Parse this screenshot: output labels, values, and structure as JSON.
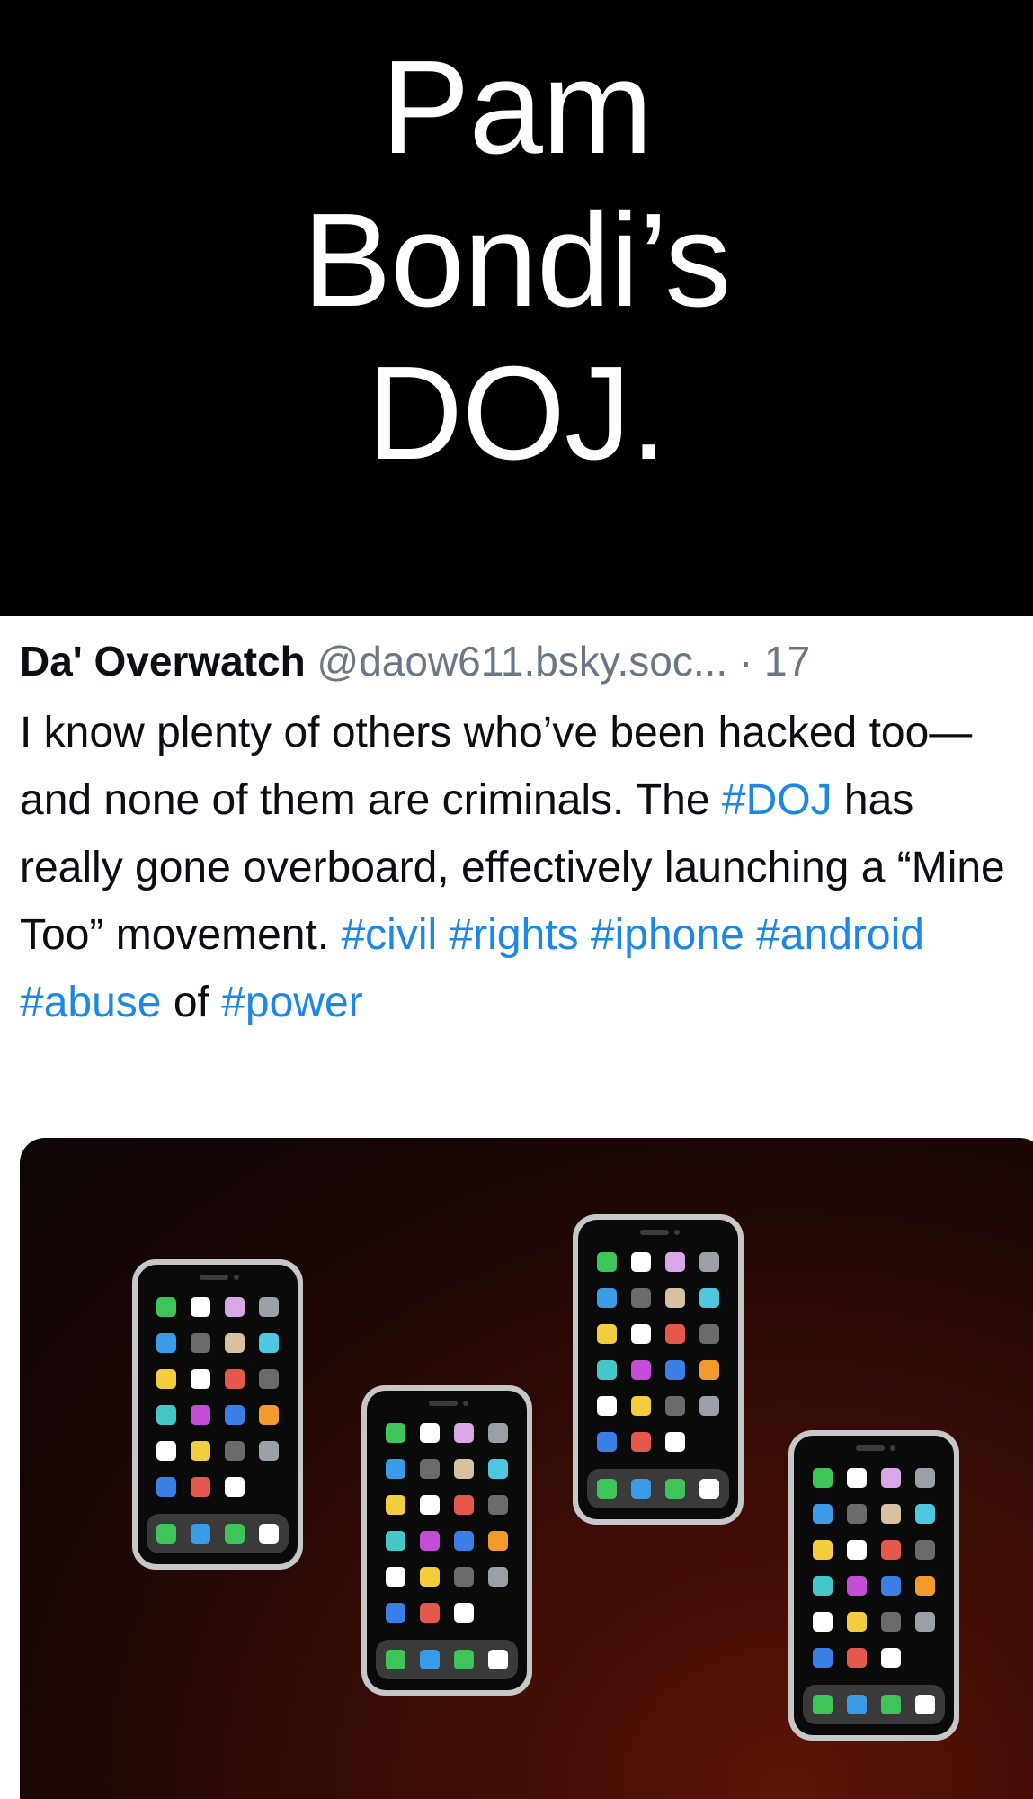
{
  "banner": {
    "line1": "Pam",
    "line2": "Bondi’s",
    "line3": "DOJ."
  },
  "post": {
    "author_name": "Da' Overwatch",
    "author_handle": "@daow611.bsky.soc...",
    "time": "· 17",
    "body": {
      "t1": "I know plenty of others who’ve been hacked too—and none of them are criminals. The ",
      "tag_doj": "#DOJ",
      "t2": " has really gone overboard, effectively launching a “Mine Too” movement. ",
      "tag_civil": "#civil",
      "tag_rights": "#rights",
      "tag_iphone": "#iphone",
      "tag_android": "#android",
      "tag_abuse": "#abuse",
      "t3": " of ",
      "tag_power": "#power"
    },
    "media": {
      "subject": "phone-icons",
      "link_color": "#1d87e4"
    }
  }
}
